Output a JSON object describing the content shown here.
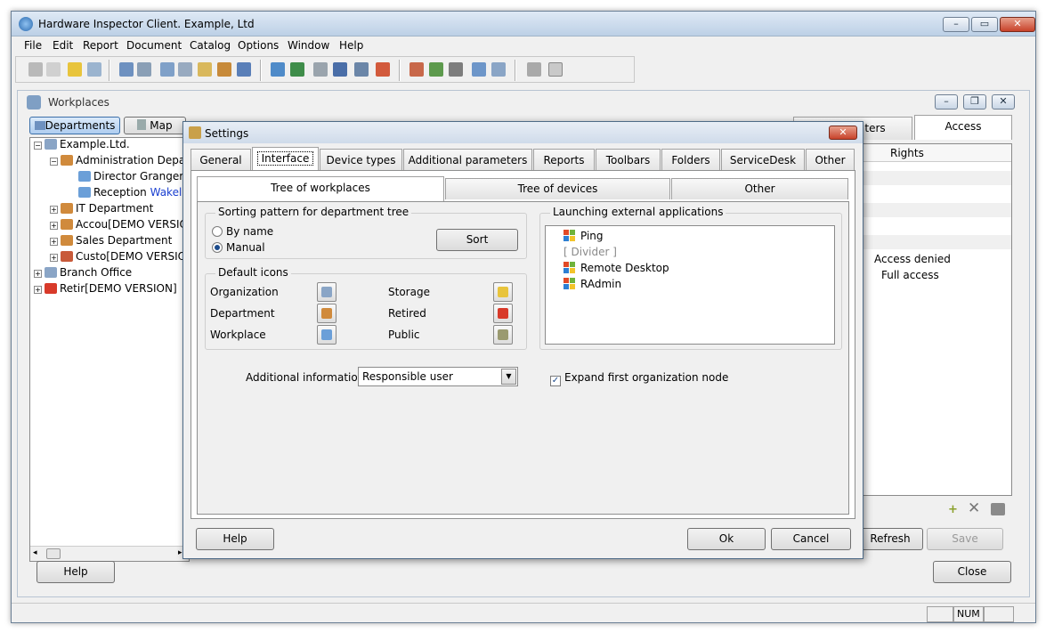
{
  "app": {
    "title": "Hardware Inspector Client. Example, Ltd"
  },
  "menu": [
    "File",
    "Edit",
    "Report",
    "Document",
    "Catalog",
    "Options",
    "Window",
    "Help"
  ],
  "workplaces": {
    "title": "Workplaces",
    "tabs": {
      "departments": "Departments",
      "map": "Map"
    },
    "tree": [
      {
        "label": "Example.Ltd.",
        "suffix": ""
      },
      {
        "label": "Administration Depa",
        "suffix": ""
      },
      {
        "label": "Director",
        "suffix": "Granger,"
      },
      {
        "label": "Reception",
        "suffix": "Wakel"
      },
      {
        "label": "IT Department",
        "suffix": ""
      },
      {
        "label": "Accou[DEMO VERSIO",
        "suffix": ""
      },
      {
        "label": "Sales Department",
        "suffix": ""
      },
      {
        "label": "Custo[DEMO VERSIO",
        "suffix": ""
      },
      {
        "label": "Branch Office",
        "suffix": ""
      },
      {
        "label": "Retir[DEMO VERSION]",
        "suffix": ""
      }
    ],
    "right_tabs": {
      "ters": "ters",
      "access": "Access"
    },
    "rights_header": "Rights",
    "rights": [
      "Access denied",
      "Full access"
    ],
    "buttons": {
      "refresh": "Refresh",
      "save": "Save",
      "help": "Help",
      "close": "Close"
    }
  },
  "status": {
    "num": "NUM"
  },
  "settings": {
    "title": "Settings",
    "tabs": [
      "General",
      "Interface",
      "Device types",
      "Additional parameters",
      "Reports",
      "Toolbars",
      "Folders",
      "ServiceDesk",
      "Other"
    ],
    "subtabs": [
      "Tree of workplaces",
      "Tree of devices",
      "Other"
    ],
    "sorting": {
      "legend": "Sorting pattern for department tree",
      "by_name": "By name",
      "manual": "Manual",
      "sort_button": "Sort"
    },
    "default_icons": {
      "legend": "Default icons",
      "organization": "Organization",
      "department": "Department",
      "workplace": "Workplace",
      "storage": "Storage",
      "retired": "Retired",
      "public": "Public"
    },
    "launching": {
      "legend": "Launching external applications",
      "items": [
        "Ping",
        "[ Divider ]",
        "Remote Desktop",
        "RAdmin"
      ]
    },
    "additional_info": {
      "label": "Additional information",
      "value": "Responsible user"
    },
    "expand_first": "Expand first organization node",
    "buttons": {
      "help": "Help",
      "ok": "Ok",
      "cancel": "Cancel"
    }
  }
}
